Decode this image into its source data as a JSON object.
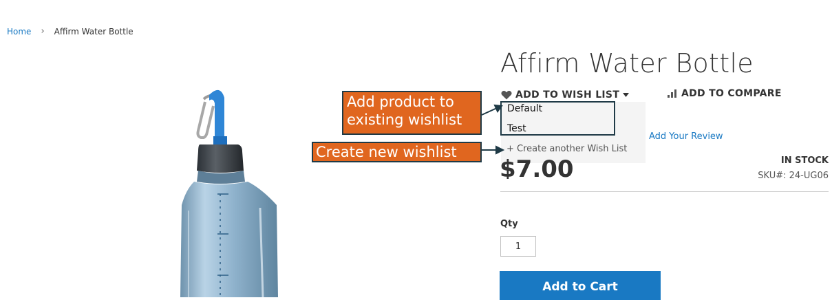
{
  "breadcrumb": {
    "home": "Home",
    "separator": "›",
    "current": "Affirm Water Bottle"
  },
  "product": {
    "title": "Affirm Water Bottle",
    "price": "$7.00",
    "stock": "IN STOCK",
    "sku_label": "SKU#:",
    "sku": "24-UG06",
    "review_link": "Add Your Review"
  },
  "actions": {
    "wishlist": "ADD TO WISH LIST",
    "compare": "ADD TO COMPARE"
  },
  "wishlist_dropdown": {
    "items": [
      "Default",
      "Test"
    ],
    "create": "+ Create another Wish List"
  },
  "purchase": {
    "qty_label": "Qty",
    "qty_value": "1",
    "add_to_cart": "Add to Cart"
  },
  "annotations": {
    "existing": [
      "Add product to",
      "existing wishlist"
    ],
    "create": "Create new wishlist"
  },
  "colors": {
    "accent": "#1979c3",
    "callout": "#e0661f",
    "callout_border": "#1f3a46"
  },
  "icons": {
    "wishlist": "heart-icon",
    "compare": "bar-chart-icon",
    "dropdown": "caret-down-icon"
  }
}
